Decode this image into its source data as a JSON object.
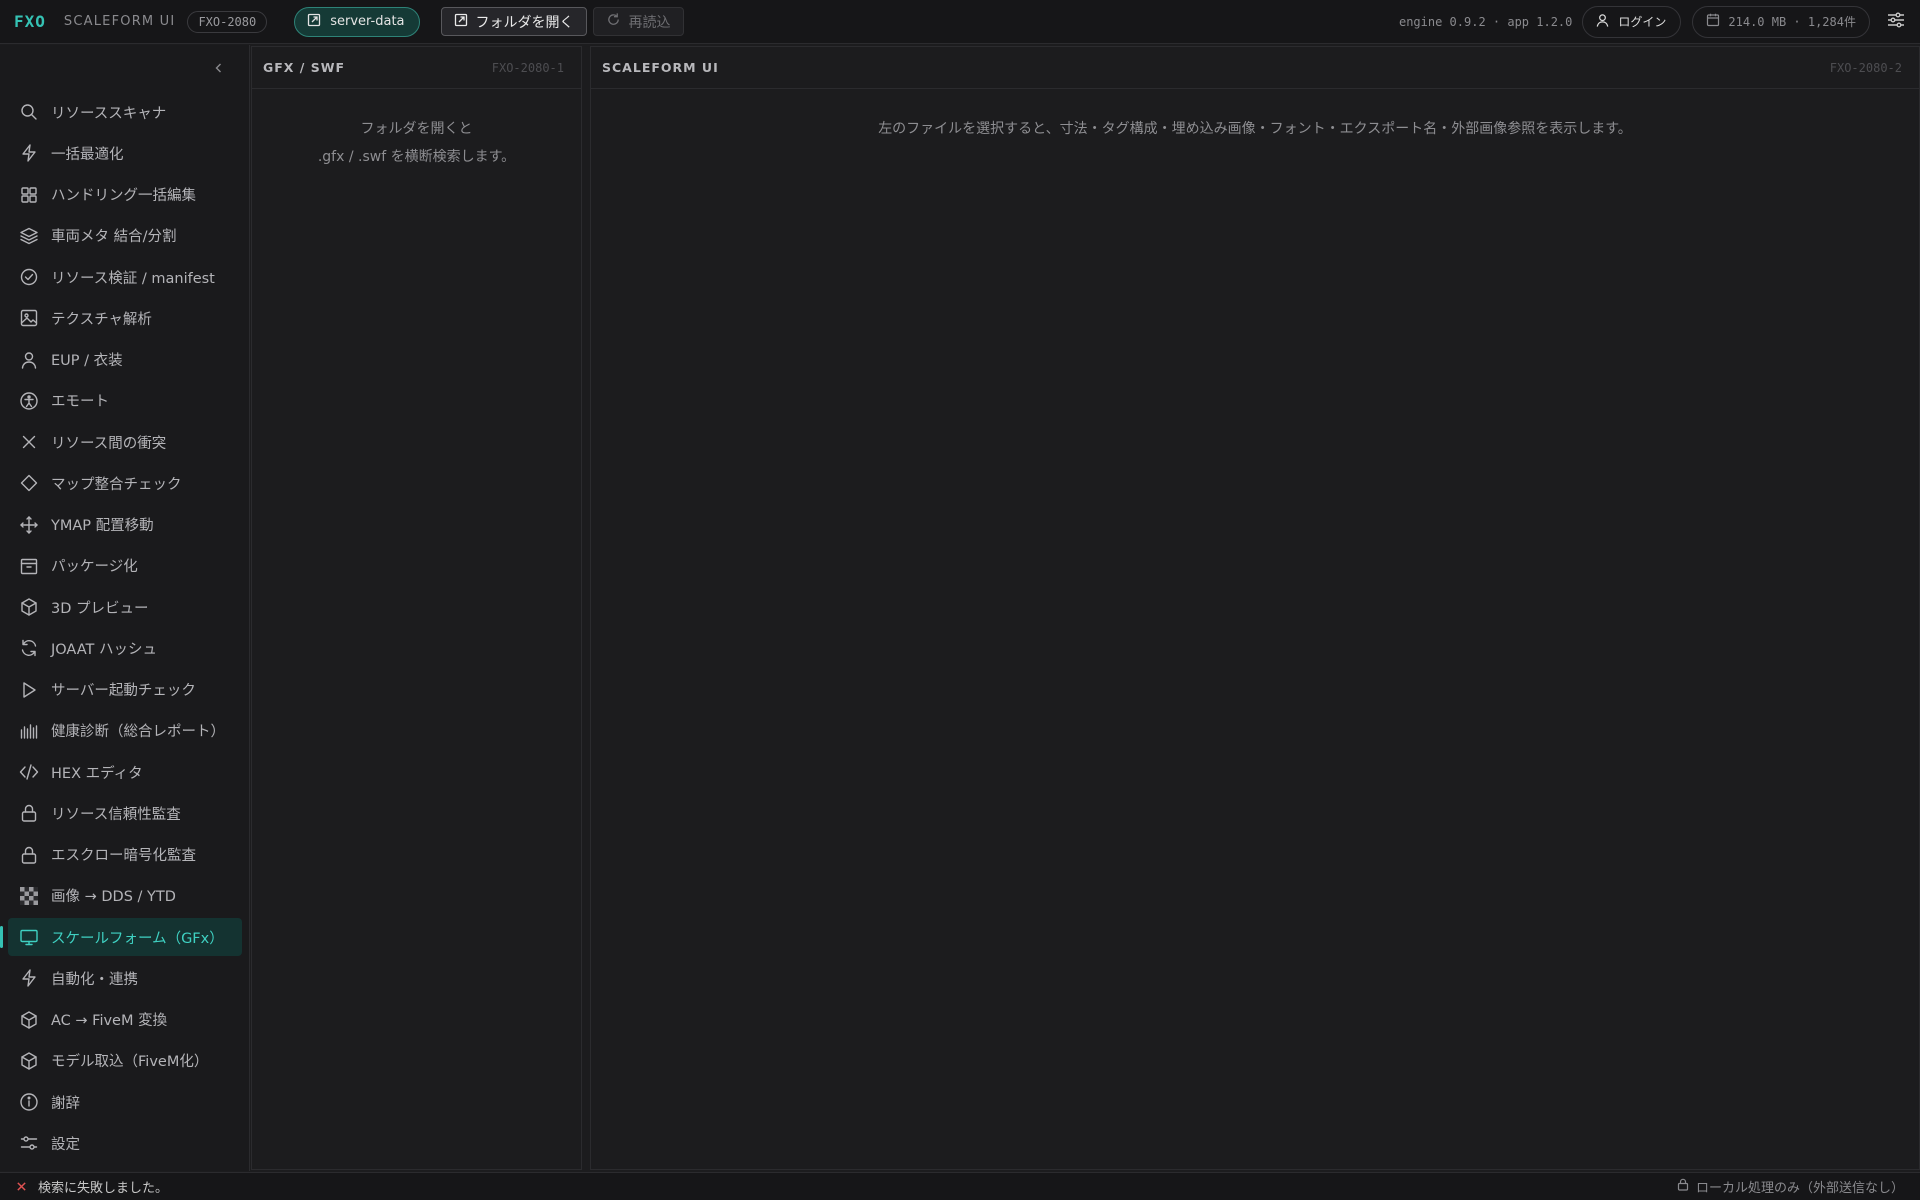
{
  "app": {
    "brand": "FXO",
    "subtitle": "SCALEFORM UI",
    "build": "FXO-2080"
  },
  "toolbar": {
    "profile": "server-data",
    "open_folder": "フォルダを開く",
    "reload": "再読込",
    "version": "engine 0.9.2 · app 1.2.0",
    "login": "ログイン",
    "cache": "214.0 MB · 1,284件"
  },
  "sidebar": {
    "items": [
      {
        "label": "リソーススキャナ",
        "icon": "search-icon"
      },
      {
        "label": "一括最適化",
        "icon": "bolt-icon"
      },
      {
        "label": "ハンドリング一括編集",
        "icon": "grid-icon"
      },
      {
        "label": "車両メタ 結合/分割",
        "icon": "layers-icon"
      },
      {
        "label": "リソース検証 / manifest",
        "icon": "check-circle-icon"
      },
      {
        "label": "テクスチャ解析",
        "icon": "image-icon"
      },
      {
        "label": "EUP / 衣装",
        "icon": "user-icon"
      },
      {
        "label": "エモート",
        "icon": "accessibility-icon"
      },
      {
        "label": "リソース間の衝突",
        "icon": "x-icon"
      },
      {
        "label": "マップ整合チェック",
        "icon": "diamond-icon"
      },
      {
        "label": "YMAP 配置移動",
        "icon": "move-icon"
      },
      {
        "label": "パッケージ化",
        "icon": "package-icon"
      },
      {
        "label": "3D プレビュー",
        "icon": "cube-icon"
      },
      {
        "label": "JOAAT ハッシュ",
        "icon": "refresh-icon"
      },
      {
        "label": "サーバー起動チェック",
        "icon": "play-icon"
      },
      {
        "label": "健康診断（総合レポート）",
        "icon": "bars-icon"
      },
      {
        "label": "HEX エディタ",
        "icon": "code-icon"
      },
      {
        "label": "リソース信頼性監査",
        "icon": "lock-icon"
      },
      {
        "label": "エスクロー暗号化監査",
        "icon": "lock-icon"
      },
      {
        "label": "画像 → DDS / YTD",
        "icon": "checker-icon"
      },
      {
        "label": "スケールフォーム（GFx）",
        "icon": "monitor-icon",
        "active": true
      },
      {
        "label": "自動化・連携",
        "icon": "bolt-icon"
      },
      {
        "label": "AC → FiveM 変換",
        "icon": "cube-icon"
      },
      {
        "label": "モデル取込（FiveM化）",
        "icon": "cube-icon"
      },
      {
        "label": "謝辞",
        "icon": "info-icon"
      },
      {
        "label": "設定",
        "icon": "sliders-icon"
      }
    ]
  },
  "left_panel": {
    "title": "GFX / SWF",
    "id": "FXO-2080-1",
    "empty_line1": "フォルダを開くと",
    "empty_line2": ".gfx / .swf を横断検索します。"
  },
  "right_panel": {
    "title": "SCALEFORM UI",
    "id": "FXO-2080-2",
    "empty_message": "左のファイルを選択すると、寸法・タグ構成・埋め込み画像・フォント・エクスポート名・外部画像参照を表示します。"
  },
  "status": {
    "error": "検索に失敗しました。",
    "local_only": "ローカル処理のみ（外部送信なし）"
  },
  "colors": {
    "accent": "#35c2b4",
    "error": "#e05252"
  }
}
